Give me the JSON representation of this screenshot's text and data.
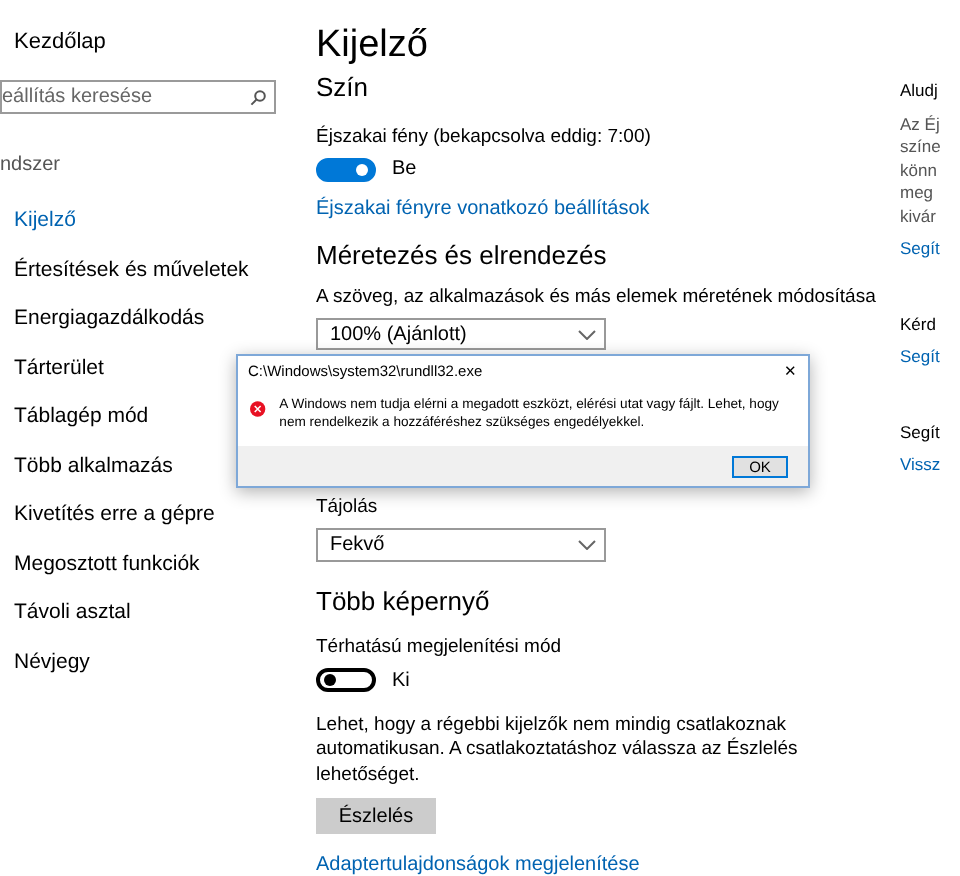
{
  "sidebar": {
    "home": "Kezdőlap",
    "search": {
      "placeholder": "eállítás keresése"
    },
    "section": "ndszer",
    "items": [
      {
        "label": "Kijelző",
        "selected": true
      },
      {
        "label": "Értesítések és műveletek",
        "selected": false
      },
      {
        "label": "Energiagazdálkodás",
        "selected": false
      },
      {
        "label": "Tárterület",
        "selected": false
      },
      {
        "label": "Táblagép mód",
        "selected": false
      },
      {
        "label": "Több alkalmazás",
        "selected": false
      },
      {
        "label": "Kivetítés erre a gépre",
        "selected": false
      },
      {
        "label": "Megosztott funkciók",
        "selected": false
      },
      {
        "label": "Távoli asztal",
        "selected": false
      },
      {
        "label": "Névjegy",
        "selected": false
      }
    ]
  },
  "main": {
    "title": "Kijelző",
    "color_section": {
      "heading": "Szín",
      "night_light": {
        "label": "Éjszakai fény (bekapcsolva eddig: 7:00)",
        "on": true,
        "state": "Be"
      },
      "link": "Éjszakai fényre vonatkozó beállítások"
    },
    "scale_section": {
      "heading": "Méretezés és elrendezés",
      "scale_label": "A szöveg, az alkalmazások és más elemek méretének módosítása",
      "scale_value": "100% (Ajánlott)",
      "orientation_label": "Tájolás",
      "orientation_value": "Fekvő"
    },
    "multi_section": {
      "heading": "Több képernyő",
      "wireless": {
        "label": "Térhatású megjelenítési mód",
        "on": false,
        "state": "Ki"
      },
      "note": "Lehet, hogy a régebbi kijelzők nem mindig csatlakoznak automatikusan. A csatlakoztatáshoz válassza az Észlelés lehetőséget.",
      "button": "Észlelés",
      "link": "Adaptertulajdonságok megjelenítése"
    }
  },
  "right_panel": [
    {
      "heading": "Aludj",
      "lines": [
        "Az Éj",
        "színe",
        "könn",
        "meg",
        "kivár"
      ],
      "link": "Segít"
    },
    {
      "heading": "Kérd",
      "link": "Segít"
    },
    {
      "heading": "Segít",
      "link": "Vissz"
    }
  ],
  "dialog": {
    "title": "C:\\Windows\\system32\\rundll32.exe",
    "close": "✕",
    "message": "A Windows nem tudja elérni a megadott eszközt, elérési utat vagy fájlt. Lehet, hogy nem rendelkezik a hozzáféréshez szükséges engedélyekkel.",
    "ok": "OK"
  }
}
